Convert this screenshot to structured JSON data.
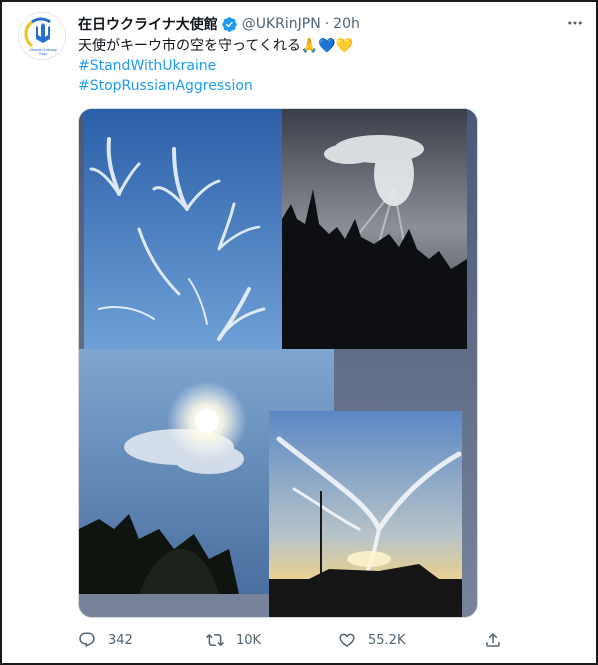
{
  "tweet": {
    "display_name": "在日ウクライナ大使館",
    "handle": "@UKRinJPN",
    "separator": "·",
    "time": "20h",
    "text_line1": "天使がキーウ市の空を守ってくれる🙏💙💛",
    "hashtag1": "#StandWithUkraine",
    "hashtag2": "#StopRussianAggression",
    "avatar_text": "Ukrainian Embassy Tokyo",
    "icons": [
      "verified-badge-icon",
      "more-options-icon",
      "reply-icon",
      "retweet-icon",
      "like-icon",
      "share-icon"
    ]
  },
  "actions": {
    "reply_count": "342",
    "retweet_count": "10K",
    "like_count": "55.2K"
  },
  "colors": {
    "link": "#1d9bf0",
    "muted": "#536471",
    "text": "#0f1419",
    "flag_blue": "#2a6fc9",
    "flag_yellow": "#f2c21b"
  }
}
